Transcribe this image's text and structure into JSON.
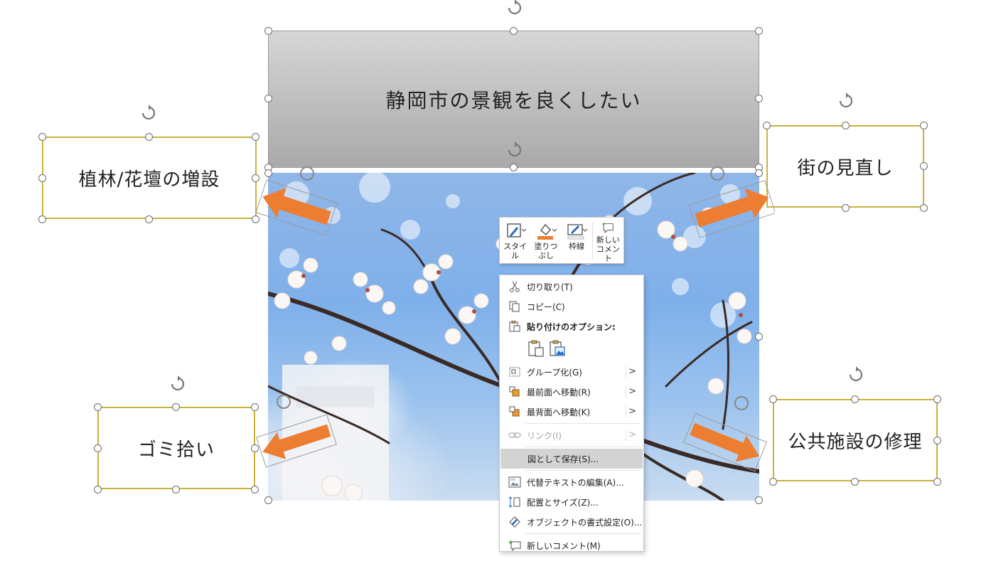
{
  "slide": {
    "title": "静岡市の景観を良くしたい",
    "callouts": {
      "top_left": "植林/花壇の増設",
      "top_right": "街の見直し",
      "bottom_left": "ゴミ拾い",
      "bottom_right": "公共施設の修理"
    },
    "arrow_color": "#ED7D31",
    "callout_border_color": "#C8B23C"
  },
  "mini_toolbar": {
    "style_label": "スタイル",
    "fill_label_1": "塗りつ",
    "fill_label_2": "ぶし",
    "outline_label": "枠線",
    "comment_label_1": "新しい",
    "comment_label_2": "コメント",
    "fill_color": "#ED7D31"
  },
  "context_menu": {
    "cut": "切り取り(T)",
    "copy": "コピー(C)",
    "paste_options": "貼り付けのオプション:",
    "group": "グループ化(G)",
    "bring_front": "最前面へ移動(R)",
    "send_back": "最背面へ移動(K)",
    "link": "リンク(I)",
    "save_as_picture": "図として保存(S)...",
    "edit_alt_text": "代替テキストの編集(A)...",
    "size_position": "配置とサイズ(Z)...",
    "format_object": "オブジェクトの書式設定(O)...",
    "new_comment": "新しいコメント(M)",
    "submenu_arrow": ">"
  }
}
